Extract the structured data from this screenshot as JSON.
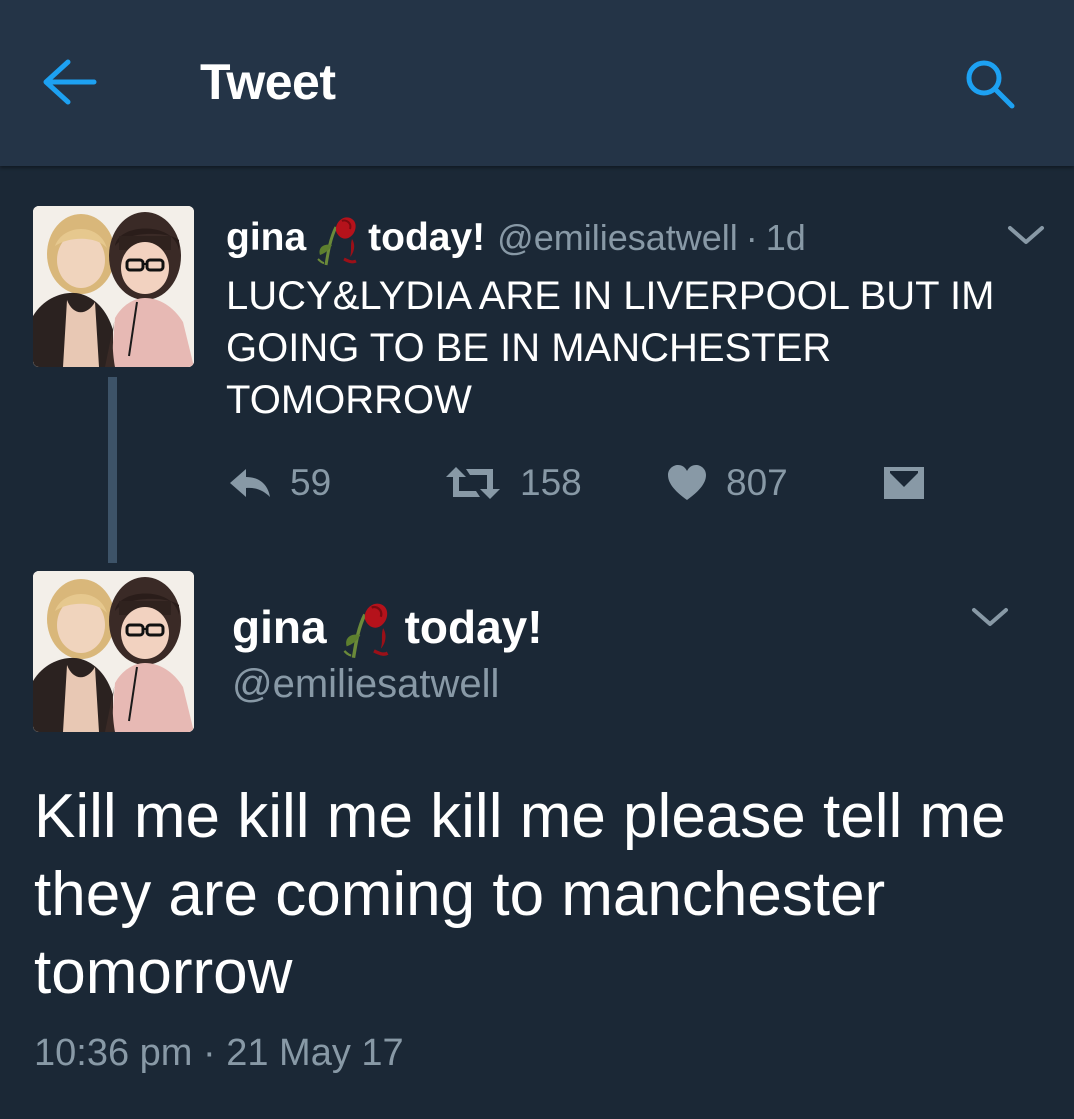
{
  "header": {
    "title": "Tweet",
    "back_icon": "arrow-left-icon",
    "search_icon": "search-icon",
    "accent_color": "#1da1f2"
  },
  "parent_tweet": {
    "name_part1": "gina",
    "emoji": "wilted-rose-emoji",
    "name_part2": "today!",
    "handle": "@emiliesatwell",
    "separator": "·",
    "time_ago": "1d",
    "text": "LUCY&LYDIA ARE IN LIVERPOOL BUT IM GOING TO BE IN MANCHESTER TOMORROW",
    "reply_count": "59",
    "retweet_count": "158",
    "like_count": "807"
  },
  "main_tweet": {
    "name_part1": "gina",
    "emoji": "wilted-rose-emoji",
    "name_part2": "today!",
    "handle": "@emiliesatwell",
    "text": "Kill me kill me kill me please tell me they are coming to manchester tomorrow",
    "timestamp": "10:36 pm · 21 May 17"
  },
  "colors": {
    "background": "#1b2836",
    "topbar": "#243447",
    "secondary_text": "#8899a6"
  }
}
